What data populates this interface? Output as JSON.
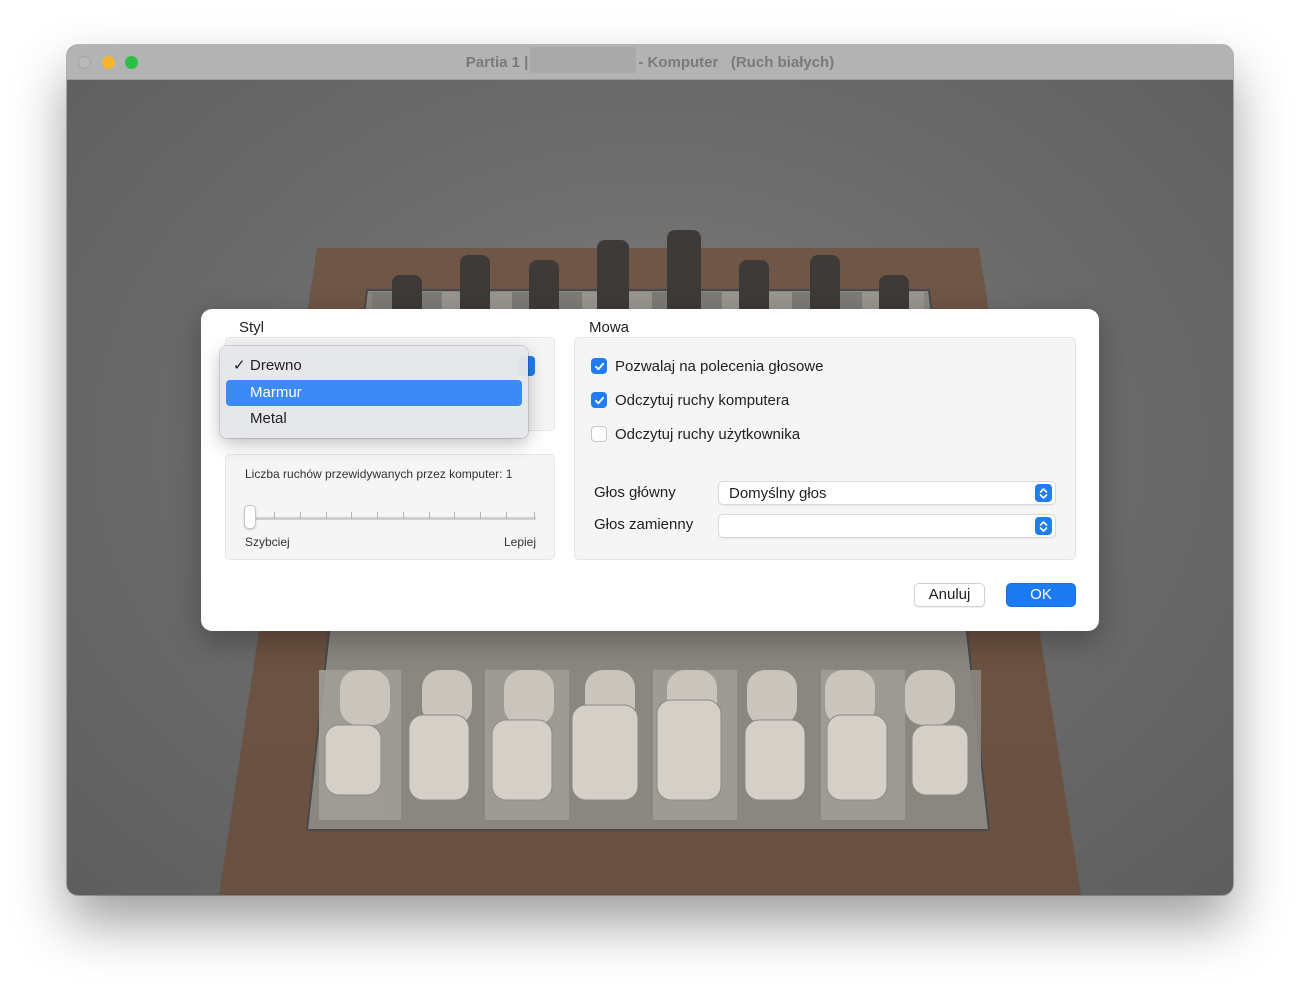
{
  "window": {
    "title_prefix": "Partia 1 |",
    "title_suffix": "- Komputer   (Ruch białych)"
  },
  "dialog": {
    "style_section": {
      "label": "Styl",
      "menu": {
        "items": [
          "Drewno",
          "Marmur",
          "Metal"
        ],
        "checked": "Drewno",
        "highlighted": "Marmur",
        "check_glyph": "✓"
      },
      "difficulty": {
        "label": "Liczba ruchów przewidywanych przez komputer: 1",
        "min_label": "Szybciej",
        "max_label": "Lepiej",
        "value": 1
      }
    },
    "speech_section": {
      "label": "Mowa",
      "checkboxes": [
        {
          "label": "Pozwalaj na polecenia głosowe",
          "checked": true
        },
        {
          "label": "Odczytuj ruchy komputera",
          "checked": true
        },
        {
          "label": "Odczytuj ruchy użytkownika",
          "checked": false
        }
      ],
      "main_voice": {
        "label": "Głos główny",
        "value": "Domyślny głos"
      },
      "alt_voice": {
        "label": "Głos zamienny",
        "value": ""
      }
    },
    "buttons": {
      "cancel": "Anuluj",
      "ok": "OK"
    }
  },
  "colors": {
    "accent": "#1f7cf2",
    "menu_highlight": "#3d8af6",
    "board_frame": "#7b6152"
  },
  "icons": {
    "close": "close-icon",
    "minimize": "minimize-icon",
    "maximize": "maximize-icon",
    "checkmark": "checkmark-icon",
    "stepper": "up-down-chevron-icon"
  }
}
